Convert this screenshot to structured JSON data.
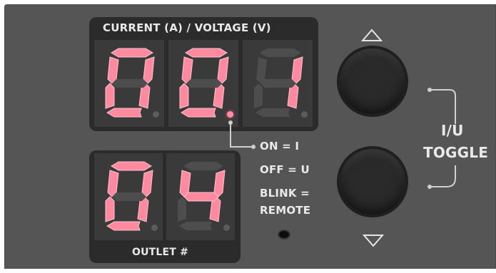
{
  "panel": {
    "display_title": "CURRENT (A) / VOLTAGE (V)",
    "outlet_label": "OUTLET #",
    "legend": {
      "on": "ON = I",
      "off": "OFF = U",
      "blink": "BLINK =",
      "remote": "REMOTE"
    },
    "toggle_label_line1": "I/U",
    "toggle_label_line2": "TOGGLE",
    "up_arrow": "△",
    "down_arrow": "▽"
  },
  "main_display": {
    "digits": [
      "0",
      "0",
      "1"
    ],
    "decimal_point_after_digit": 2,
    "text": "00.1"
  },
  "outlet_display": {
    "digits": [
      "0",
      "4"
    ],
    "text": "04"
  },
  "colors": {
    "segment_on": "#ff8aa0",
    "segment_off": "#4d4d4d",
    "panel": "#555555",
    "bezel": "#2b2b2b"
  },
  "icons": {
    "up": "up-triangle-icon",
    "down": "down-triangle-icon"
  }
}
